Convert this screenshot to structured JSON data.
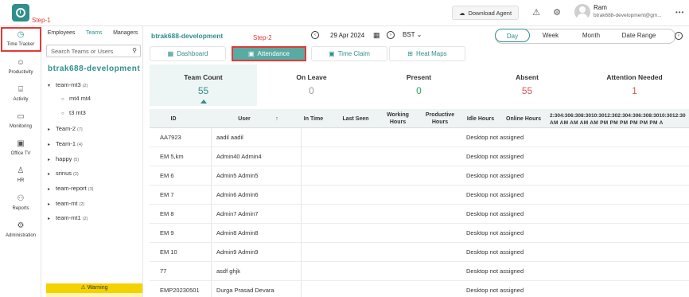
{
  "annotations": {
    "step1": "Step-1",
    "step2": "Step-2"
  },
  "topbar": {
    "download_label": "Download Agent",
    "user_name": "Ram",
    "user_email": "btrak688-development@gm..."
  },
  "leftnav": [
    {
      "label": "Time Tracker",
      "icon": "clock-icon",
      "active": true
    },
    {
      "label": "Productivity",
      "icon": "people-icon"
    },
    {
      "label": "Activity",
      "icon": "activity-icon"
    },
    {
      "label": "Monitoring",
      "icon": "monitor-icon"
    },
    {
      "label": "Office TV",
      "icon": "tv-icon"
    },
    {
      "label": "HR",
      "icon": "person-icon"
    },
    {
      "label": "Reports",
      "icon": "reports-icon"
    },
    {
      "label": "Administration",
      "icon": "gear-icon"
    }
  ],
  "teampanel": {
    "tabs": [
      "Employees",
      "Teams",
      "Managers"
    ],
    "active_tab": "Teams",
    "search_placeholder": "Search Teams or Users",
    "org_name": "btrak688-development",
    "tree": [
      {
        "label": "team-mt3",
        "count": "(2)",
        "expanded": true,
        "level": 0
      },
      {
        "label": "mt4 mt4",
        "count": "",
        "level": 1
      },
      {
        "label": "t3 mt3",
        "count": "",
        "level": 1
      },
      {
        "label": "Team-2",
        "count": "(7)",
        "level": 0
      },
      {
        "label": "Team-1",
        "count": "(4)",
        "level": 0
      },
      {
        "label": "happy",
        "count": "(5)",
        "level": 0
      },
      {
        "label": "srinus",
        "count": "(2)",
        "level": 0
      },
      {
        "label": "team-report",
        "count": "(3)",
        "level": 0
      },
      {
        "label": "team-mt",
        "count": "(2)",
        "level": 0
      },
      {
        "label": "team-mt1",
        "count": "(2)",
        "level": 0
      }
    ],
    "warning_label": "Warning"
  },
  "main": {
    "title": "btrak688-development",
    "date": "29 Apr 2024",
    "timezone": "BST",
    "ranges": [
      "Day",
      "Week",
      "Month",
      "Date Range"
    ],
    "active_range": "Day",
    "subtabs": [
      "Dashboard",
      "Attendance",
      "Time Claim",
      "Heat Maps"
    ],
    "active_subtab": "Attendance",
    "stats": [
      {
        "label": "Team Count",
        "value": "55",
        "color": "#2f8f8a"
      },
      {
        "label": "On Leave",
        "value": "0",
        "color": "#999999"
      },
      {
        "label": "Present",
        "value": "0",
        "color": "#2e9e5b"
      },
      {
        "label": "Absent",
        "value": "55",
        "color": "#e05555"
      },
      {
        "label": "Attention Needed",
        "value": "1",
        "color": "#e05555"
      }
    ],
    "columns": [
      "ID",
      "User",
      "In Time",
      "Last Seen",
      "Working Hours",
      "Productive Hours",
      "Idle Hours",
      "Online Hours"
    ],
    "time_header_line1": "2:304:306:308:3010:3012:302:304:306:308:3010:3012:30",
    "time_header_line2": "AM AM AM AM AM PM PM PM PM PM PM A",
    "rows": [
      {
        "id": "AA7923",
        "user": "aadil aadil",
        "status": "Desktop not assigned"
      },
      {
        "id": "EM 5,km",
        "user": "Admin40 Admin4",
        "status": "Desktop not assigned"
      },
      {
        "id": "EM 6",
        "user": "Admin5 Admin5",
        "status": "Desktop not assigned"
      },
      {
        "id": "EM 7",
        "user": "Admin6 Admin6",
        "status": "Desktop not assigned"
      },
      {
        "id": "EM 8",
        "user": "Admin7 Admin7",
        "status": "Desktop not assigned"
      },
      {
        "id": "EM 9",
        "user": "Admin8 Admin8",
        "status": "Desktop not assigned"
      },
      {
        "id": "EM 10",
        "user": "Admin9 Admin9",
        "status": "Desktop not assigned"
      },
      {
        "id": "77",
        "user": "asdf ghjk",
        "status": "Desktop not assigned"
      },
      {
        "id": "EMP20230501",
        "user": "Durga Prasad Devara",
        "status": "Desktop not assigned"
      }
    ]
  }
}
